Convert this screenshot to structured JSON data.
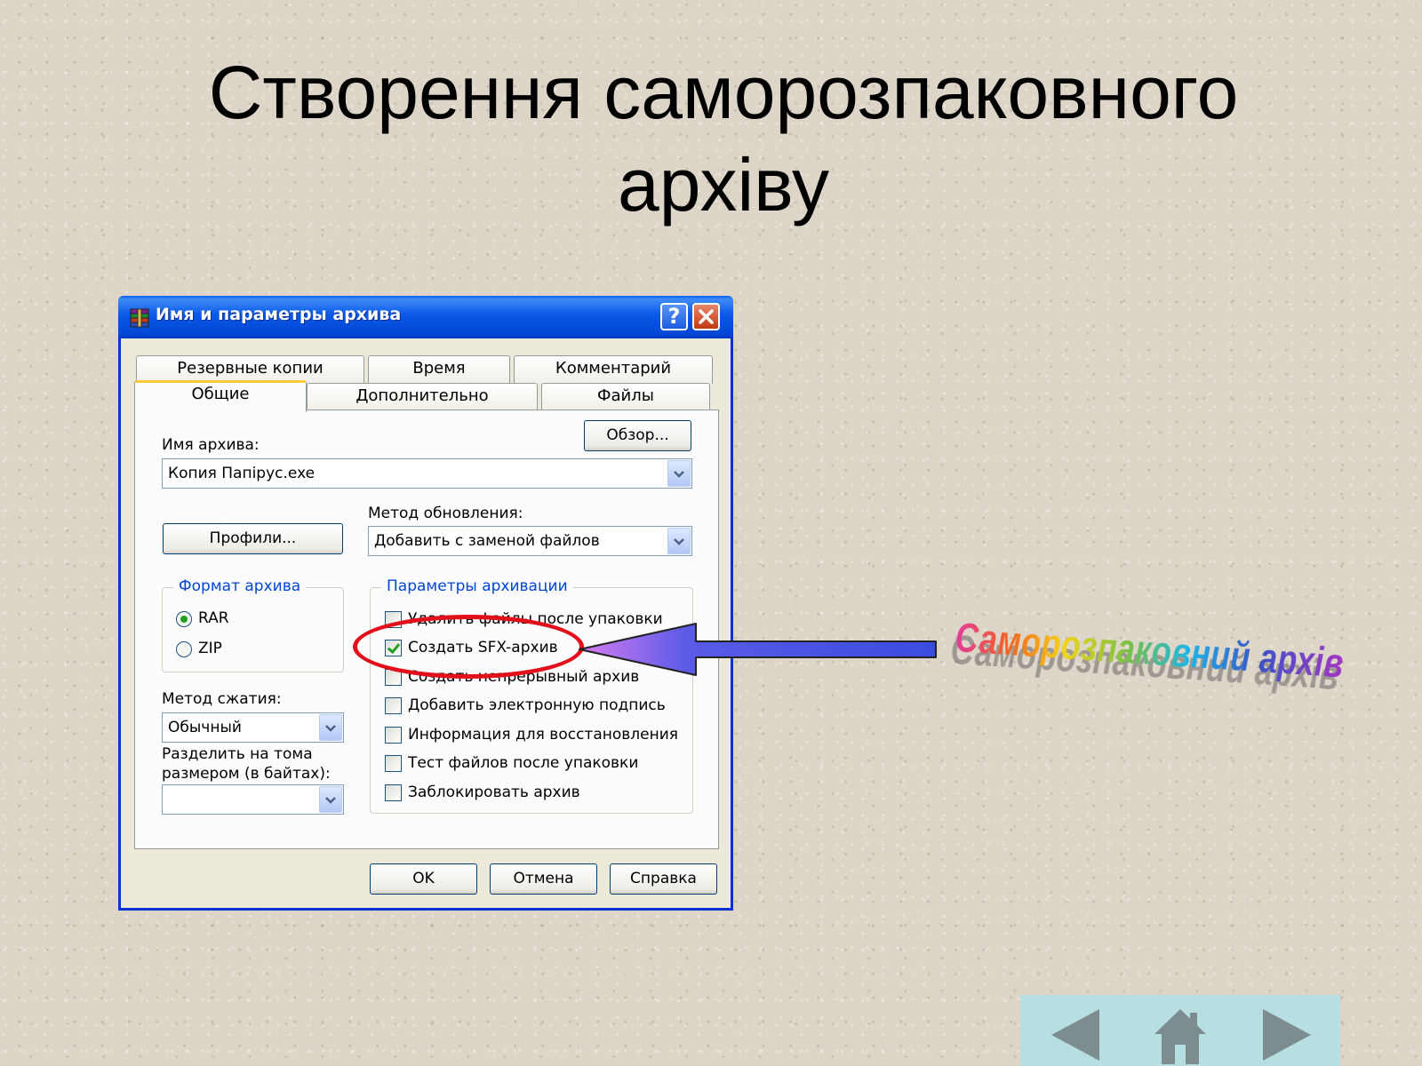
{
  "slide": {
    "title_line1": "Створення саморозпаковного",
    "title_line2": "архіву",
    "annotation": "Саморозпаковний архів"
  },
  "dialog": {
    "title": "Имя и параметры архива",
    "help_label": "?",
    "tabs_back": [
      "Резервные копии",
      "Время",
      "Комментарий"
    ],
    "tabs_front": [
      "Общие",
      "Дополнительно",
      "Файлы"
    ],
    "active_tab": "Общие",
    "archive_name_label": "Имя архива:",
    "browse_label": "Обзор...",
    "archive_name_value": "Копия Папірус.exe",
    "profiles_label": "Профили...",
    "update_method_label": "Метод обновления:",
    "update_method_value": "Добавить с заменой файлов",
    "format_group_label": "Формат архива",
    "formats": [
      "RAR",
      "ZIP"
    ],
    "selected_format": "RAR",
    "compression_label": "Метод сжатия:",
    "compression_value": "Обычный",
    "split_label_line1": "Разделить на тома",
    "split_label_line2": "размером (в байтах):",
    "split_value": "",
    "options_group_label": "Параметры архивации",
    "options": [
      {
        "label": "Удалить файлы после упаковки",
        "checked": false
      },
      {
        "label": "Создать SFX-архив",
        "checked": true
      },
      {
        "label": "Создать непрерывный архив",
        "checked": false
      },
      {
        "label": "Добавить электронную подпись",
        "checked": false
      },
      {
        "label": "Информация для восстановления",
        "checked": false
      },
      {
        "label": "Тест файлов после упаковки",
        "checked": false
      },
      {
        "label": "Заблокировать архив",
        "checked": false
      }
    ],
    "ok_label": "OK",
    "cancel_label": "Отмена",
    "help_button_label": "Справка"
  },
  "colors": {
    "titlebar": "#0a58e6",
    "highlight": "#e2101b",
    "arrow_fill": "#4a4ee0",
    "nav_panel": "#b7dfe2"
  },
  "icons": {
    "app": "winrar-books-icon",
    "close": "close-icon",
    "help": "help-icon",
    "nav": [
      "prev-arrow-icon",
      "home-icon",
      "next-arrow-icon"
    ]
  }
}
